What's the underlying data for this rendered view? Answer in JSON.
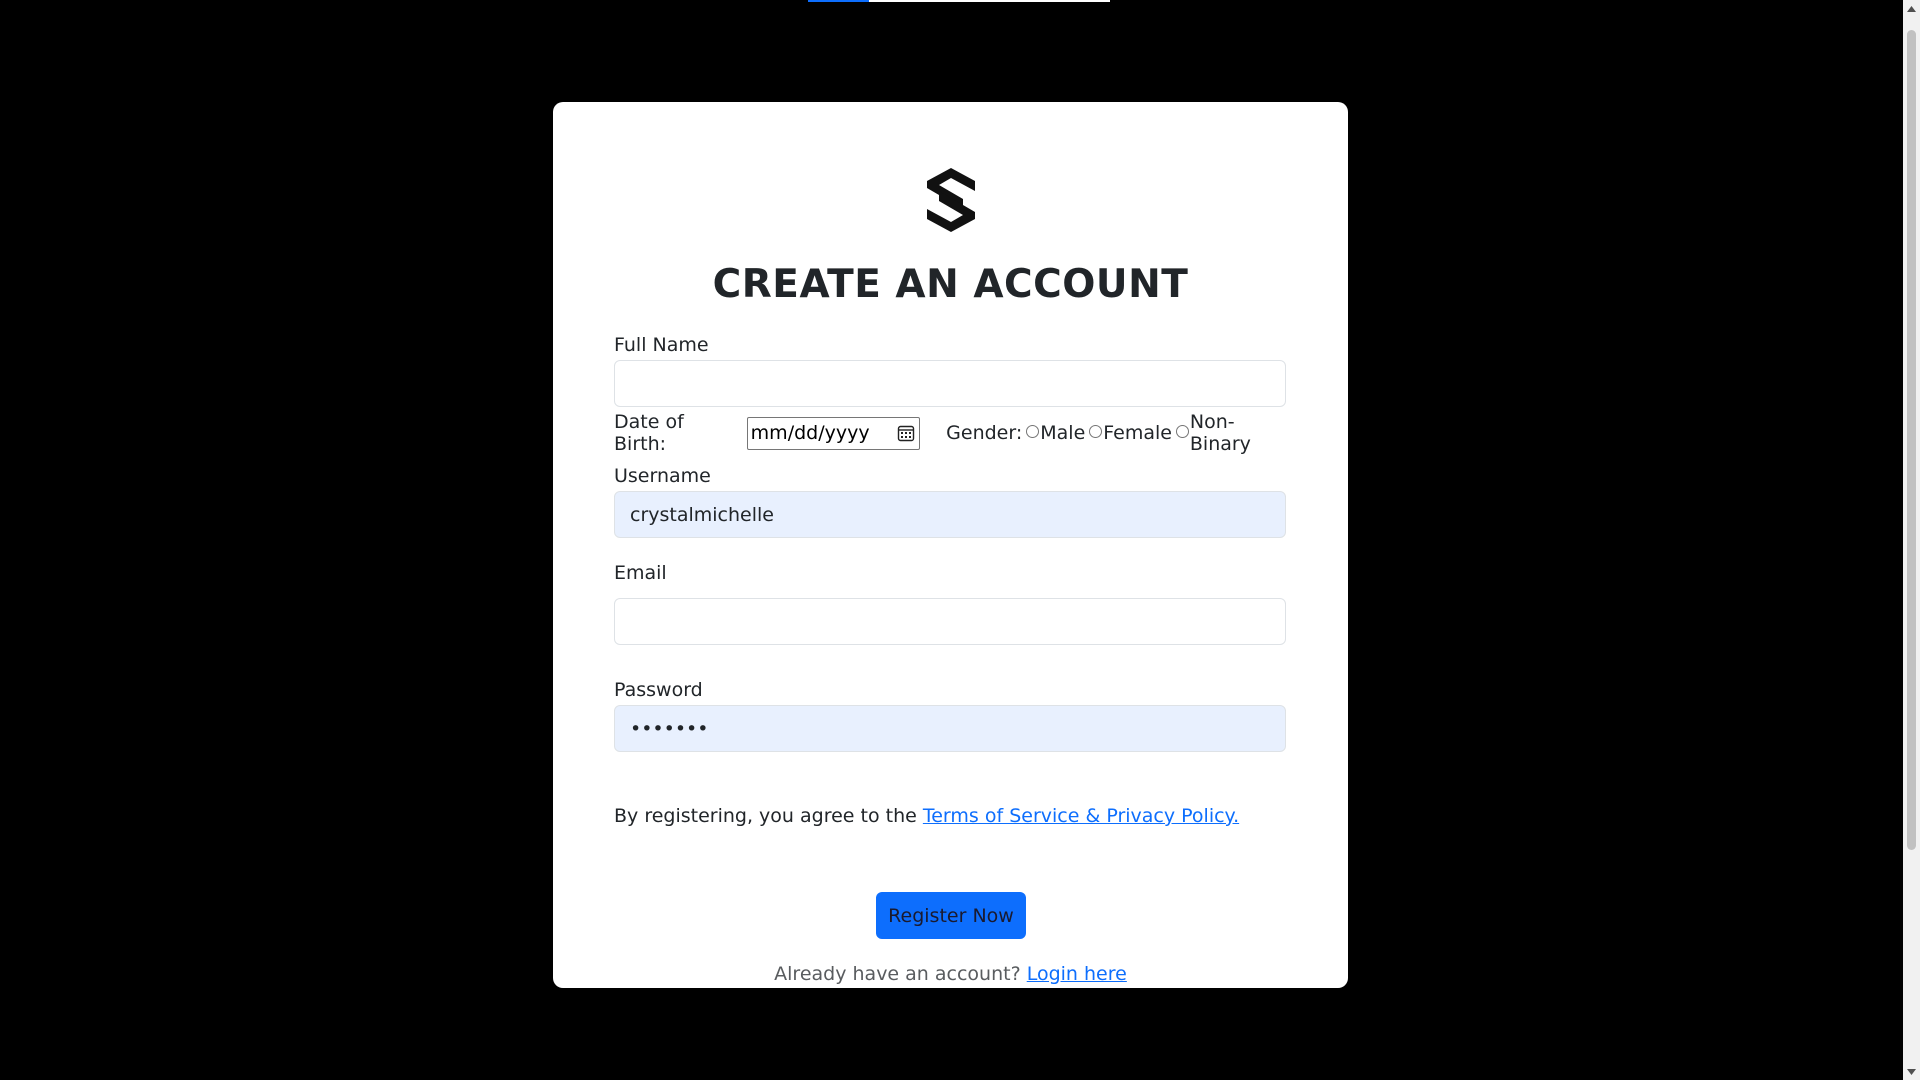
{
  "page": {
    "background_color": "#000000",
    "accent_color": "#0d6efd"
  },
  "logo": {
    "icon": "brand-s-logo-icon"
  },
  "form": {
    "title": "CREATE AN ACCOUNT",
    "full_name": {
      "label": "Full Name",
      "value": ""
    },
    "dob": {
      "label": "Date of Birth:",
      "placeholder": "mm/dd/yyyy",
      "icon": "calendar-icon"
    },
    "gender": {
      "label": "Gender:",
      "options": [
        "Male",
        "Female",
        "Non-Binary"
      ]
    },
    "username": {
      "label": "Username",
      "value": "crystalmichelle"
    },
    "email": {
      "label": "Email",
      "value": ""
    },
    "password": {
      "label": "Password",
      "value": "•••••••"
    },
    "terms": {
      "prefix": "By registering, you agree to the ",
      "link": "Terms of Service & Privacy Policy."
    },
    "register_button": "Register Now",
    "login": {
      "prefix": "Already have an account? ",
      "link": "Login here"
    }
  },
  "scrollbar": {
    "up_icon": "scroll-up-arrow-icon",
    "down_icon": "scroll-down-arrow-icon"
  }
}
